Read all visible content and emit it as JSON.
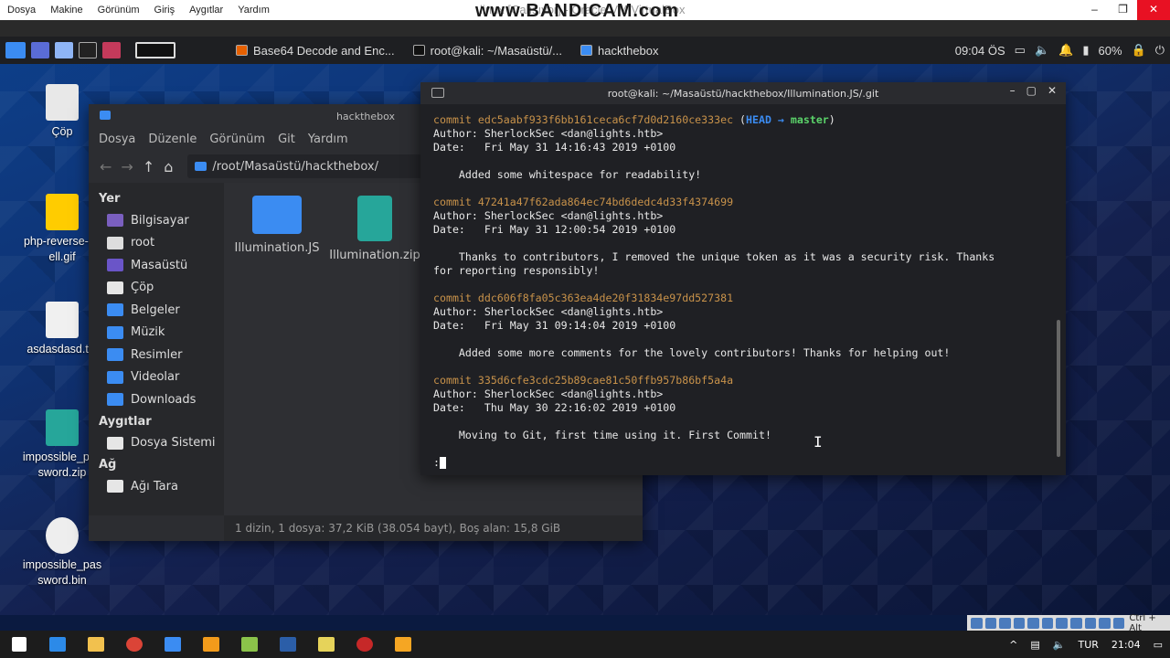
{
  "host": {
    "menu": [
      "Dosya",
      "Makine",
      "Görünüm",
      "Giriş",
      "Aygıtlar",
      "Yardım"
    ],
    "window_title": "linux [Çalışıyor] - Oracle VM VirtualBox",
    "watermark": "www.BANDICAM.com"
  },
  "panel": {
    "tasks": [
      {
        "label": "Base64 Decode and Enc...",
        "icon": "firefox-icon"
      },
      {
        "label": "root@kali: ~/Masaüstü/...",
        "icon": "terminal-icon"
      },
      {
        "label": "hackthebox",
        "icon": "folder-icon"
      }
    ],
    "clock": "09:04 ÖS",
    "battery": "60%"
  },
  "desktop_icons": [
    {
      "label": "Çöp"
    },
    {
      "label": "php-reverse-shell.gif"
    },
    {
      "label": "asdasdasd.txt"
    },
    {
      "label": "impossible_password.zip"
    },
    {
      "label": "impossible_password.bin"
    }
  ],
  "file_manager": {
    "title": "hackthebox",
    "menu": [
      "Dosya",
      "Düzenle",
      "Görünüm",
      "Git",
      "Yardım"
    ],
    "path": "/root/Masaüstü/hackthebox/",
    "sections": {
      "places": "Yer",
      "devices": "Aygıtlar",
      "network": "Ağ"
    },
    "places": [
      {
        "label": "Bilgisayar",
        "color": "#7a5fbf"
      },
      {
        "label": "root",
        "color": "#dddddd"
      },
      {
        "label": "Masaüstü",
        "color": "#6a55c8"
      },
      {
        "label": "Çöp",
        "color": "#e6e6e6"
      },
      {
        "label": "Belgeler",
        "color": "#3b8cf2"
      },
      {
        "label": "Müzik",
        "color": "#3b8cf2"
      },
      {
        "label": "Resimler",
        "color": "#3b8cf2"
      },
      {
        "label": "Videolar",
        "color": "#3b8cf2"
      },
      {
        "label": "Downloads",
        "color": "#3b8cf2"
      }
    ],
    "devices": [
      {
        "label": "Dosya Sistemi"
      }
    ],
    "network": [
      {
        "label": "Ağı Tara"
      }
    ],
    "files": [
      {
        "name": "Illumination.JS",
        "type": "folder"
      },
      {
        "name": "Illumination.zip",
        "type": "zip"
      }
    ],
    "status": "1 dizin, 1 dosya: 37,2 KiB (38.054 bayt), Boş alan: 15,8 GiB"
  },
  "terminal": {
    "title": "root@kali: ~/Masaüstü/hackthebox/Illumination.JS/.git",
    "commits": [
      {
        "commit": "commit edc5aabf933f6bb161ceca6cf7d0d2160ce333ec",
        "head": "HEAD -> master",
        "author": "Author: SherlockSec <dan@lights.htb>",
        "date": "Date:   Fri May 31 14:16:43 2019 +0100",
        "message": "    Added some whitespace for readability!"
      },
      {
        "commit": "commit 47241a47f62ada864ec74bd6dedc4d33f4374699",
        "head": "",
        "author": "Author: SherlockSec <dan@lights.htb>",
        "date": "Date:   Fri May 31 12:00:54 2019 +0100",
        "message": "    Thanks to contributors, I removed the unique token as it was a security risk. Thanks\nfor reporting responsibly!"
      },
      {
        "commit": "commit ddc606f8fa05c363ea4de20f31834e97dd527381",
        "head": "",
        "author": "Author: SherlockSec <dan@lights.htb>",
        "date": "Date:   Fri May 31 09:14:04 2019 +0100",
        "message": "    Added some more comments for the lovely contributors! Thanks for helping out!"
      },
      {
        "commit": "commit 335d6cfe3cdc25b89cae81c50ffb957b86bf5a4a",
        "head": "",
        "author": "Author: SherlockSec <dan@lights.htb>",
        "date": "Date:   Thu May 30 22:16:02 2019 +0100",
        "message": "    Moving to Git, first time using it. First Commit!"
      }
    ],
    "prompt": ":"
  },
  "taskbar": {
    "lang": "TUR",
    "time": "21:04",
    "host_key": "Ctrl + Alt"
  }
}
